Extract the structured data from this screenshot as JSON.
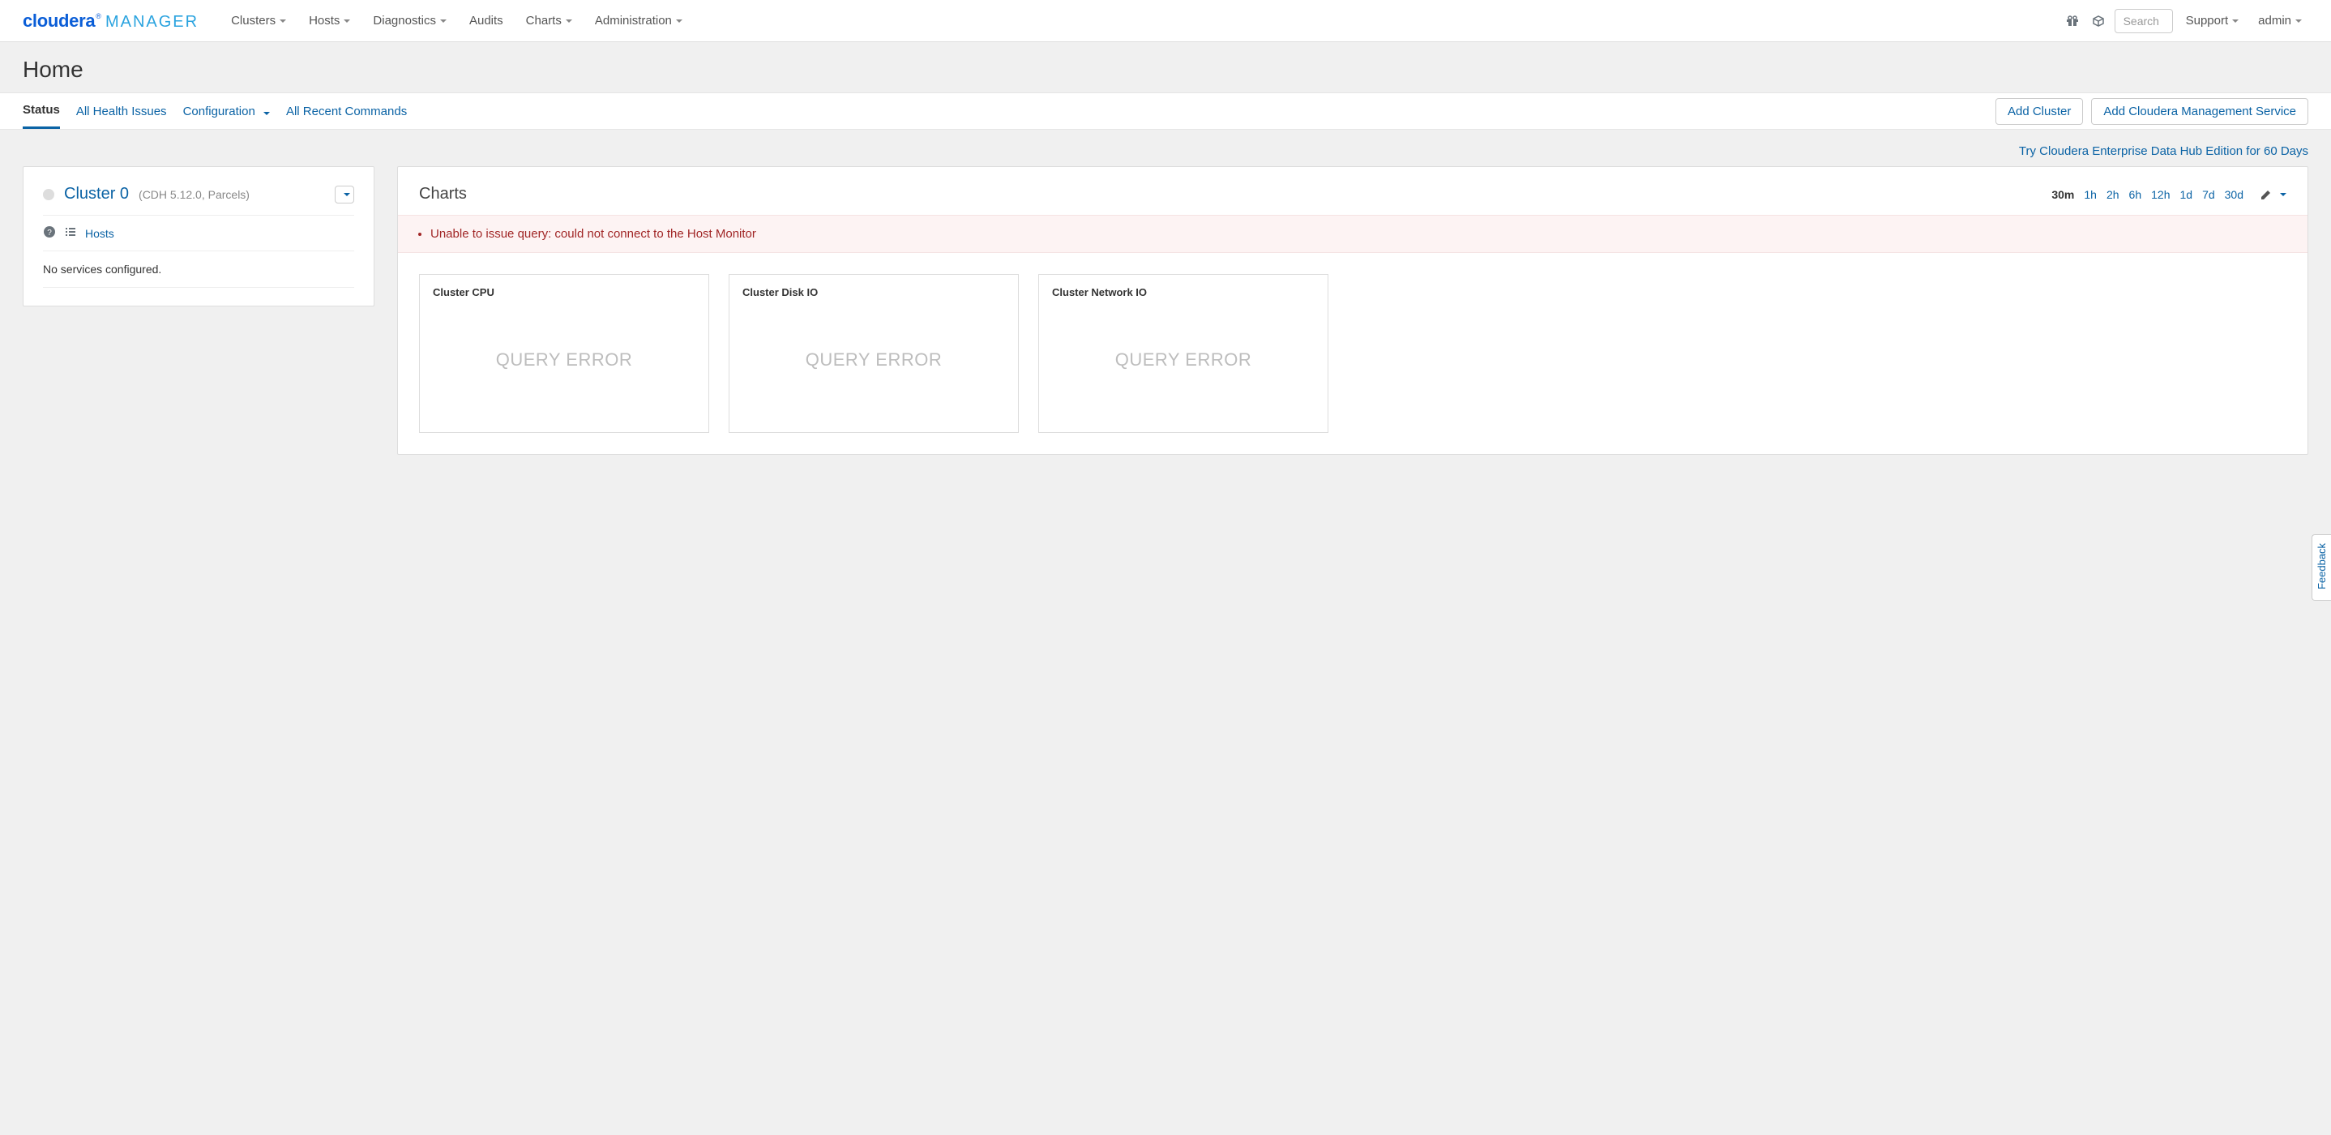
{
  "brand": {
    "part1": "cloudera",
    "part2": "MANAGER"
  },
  "nav": {
    "clusters": "Clusters",
    "hosts": "Hosts",
    "diagnostics": "Diagnostics",
    "audits": "Audits",
    "charts": "Charts",
    "administration": "Administration"
  },
  "search": {
    "placeholder": "Search"
  },
  "nav_right": {
    "support": "Support",
    "admin": "admin"
  },
  "page_title": "Home",
  "tabs": {
    "status": "Status",
    "health": "All Health Issues",
    "configuration": "Configuration",
    "recent_commands": "All Recent Commands"
  },
  "actions": {
    "add_cluster": "Add Cluster",
    "add_cms": "Add Cloudera Management Service"
  },
  "promo": "Try Cloudera Enterprise Data Hub Edition for 60 Days",
  "cluster": {
    "name": "Cluster 0",
    "meta": "(CDH 5.12.0, Parcels)",
    "hosts_label": "Hosts",
    "no_services": "No services configured."
  },
  "charts": {
    "heading": "Charts",
    "ranges": [
      "30m",
      "1h",
      "2h",
      "6h",
      "12h",
      "1d",
      "7d",
      "30d"
    ],
    "active_range": "30m",
    "error": "Unable to issue query: could not connect to the Host Monitor",
    "tiles": [
      {
        "title": "Cluster CPU",
        "body": "QUERY ERROR"
      },
      {
        "title": "Cluster Disk IO",
        "body": "QUERY ERROR"
      },
      {
        "title": "Cluster Network IO",
        "body": "QUERY ERROR"
      }
    ]
  },
  "feedback": "Feedback"
}
